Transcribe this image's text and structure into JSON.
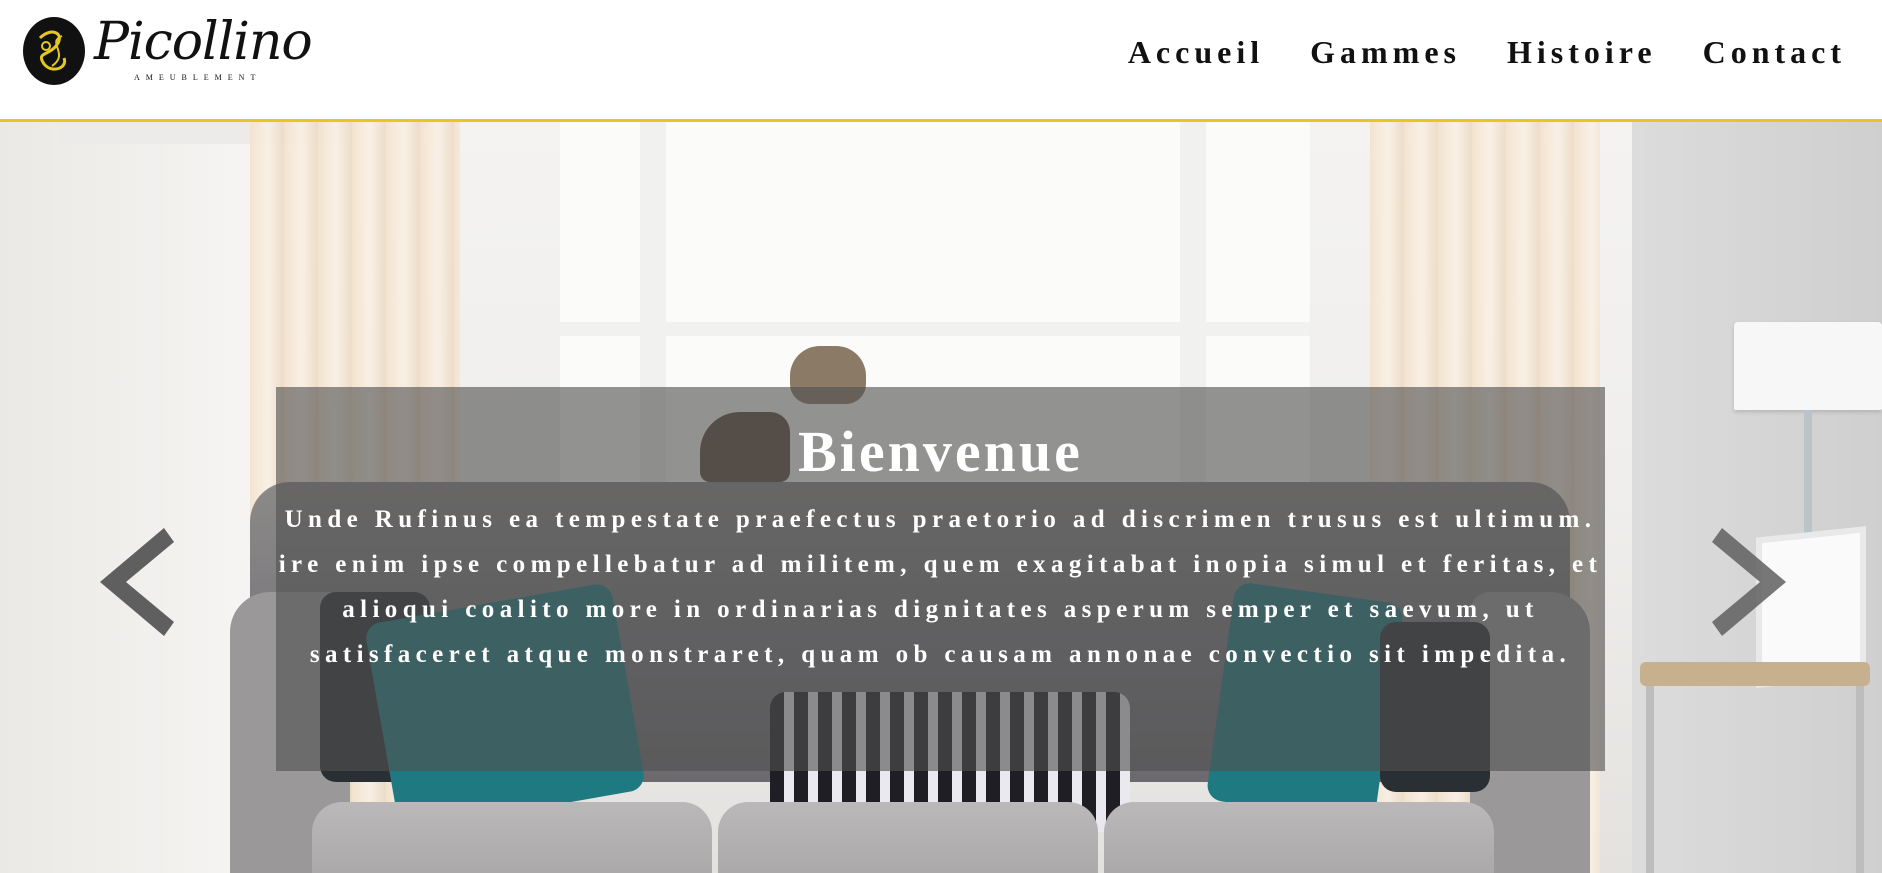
{
  "brand": {
    "name": "Picollino",
    "tagline": "AMEUBLEMENT",
    "emblem_icon": "monogram-emblem-icon",
    "emblem_color": "#e2c821"
  },
  "nav": {
    "items": [
      "Accueil",
      "Gammes",
      "Histoire",
      "Contact"
    ]
  },
  "colors": {
    "accent": "#e2c821",
    "caption_bg": "rgba(80,80,80,0.62)"
  },
  "hero": {
    "title": "Bienvenue",
    "text": "Unde Rufinus ea tempestate praefectus praetorio ad discrimen trusus est ultimum. ire enim ipse compellebatur ad militem, quem exagitabat inopia simul et feritas, et alioqui coalito more in ordinarias dignitates asperum semper et saevum, ut satisfaceret atque monstraret, quam ob causam annonae convectio sit impedita.",
    "prev_icon": "chevron-left-icon",
    "next_icon": "chevron-right-icon"
  }
}
